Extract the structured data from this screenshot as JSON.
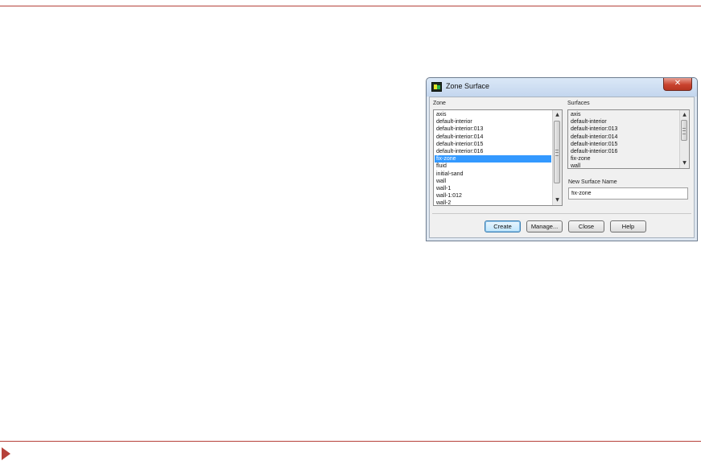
{
  "dialog": {
    "title": "Zone Surface",
    "close_glyph": "✕"
  },
  "zone": {
    "label": "Zone",
    "items": [
      {
        "label": "axis",
        "selected": false
      },
      {
        "label": "default-interior",
        "selected": false
      },
      {
        "label": "default-interior:013",
        "selected": false
      },
      {
        "label": "default-interior:014",
        "selected": false
      },
      {
        "label": "default-interior:015",
        "selected": false
      },
      {
        "label": "default-interior:016",
        "selected": false
      },
      {
        "label": "fix-zone",
        "selected": true
      },
      {
        "label": "fluid",
        "selected": false
      },
      {
        "label": "initial-sand",
        "selected": false
      },
      {
        "label": "wall",
        "selected": false
      },
      {
        "label": "wall-1",
        "selected": false
      },
      {
        "label": "wall-1:012",
        "selected": false
      },
      {
        "label": "wall-2",
        "selected": false
      }
    ]
  },
  "surfaces": {
    "label": "Surfaces",
    "items": [
      {
        "label": "axis",
        "selected": false
      },
      {
        "label": "default-interior",
        "selected": false
      },
      {
        "label": "default-interior:013",
        "selected": false
      },
      {
        "label": "default-interior:014",
        "selected": false
      },
      {
        "label": "default-interior:015",
        "selected": false
      },
      {
        "label": "default-interior:016",
        "selected": false
      },
      {
        "label": "fix-zone",
        "selected": false
      },
      {
        "label": "wall",
        "selected": false
      }
    ]
  },
  "new_surface": {
    "label": "New Surface Name",
    "value": "fix-zone"
  },
  "buttons": {
    "create": "Create",
    "manage": "Manage...",
    "close": "Close",
    "help": "Help"
  },
  "scroll": {
    "up_glyph": "▲",
    "down_glyph": "▼"
  }
}
